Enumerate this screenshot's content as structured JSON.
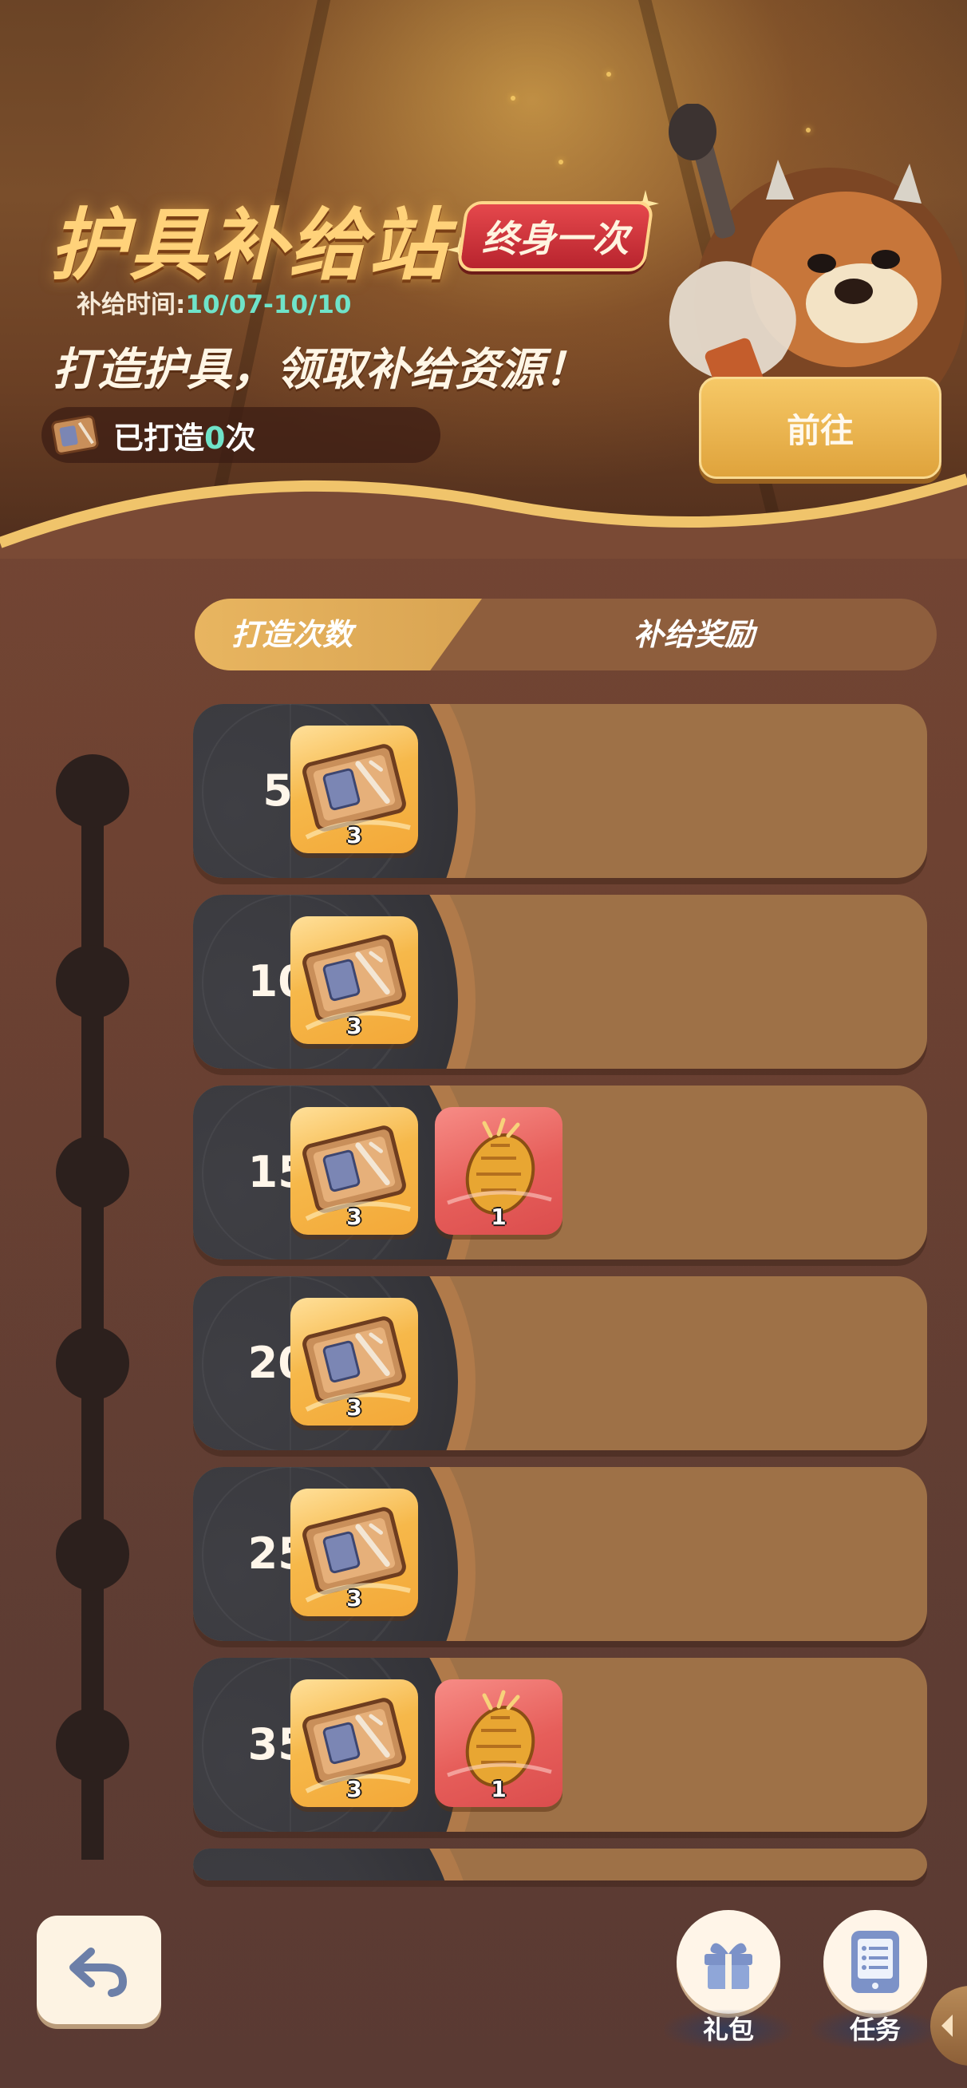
{
  "banner": {
    "title": "护具补给站",
    "badge": "终身一次",
    "supply_time_label": "补给时间:",
    "supply_time_value": "10/07-10/10",
    "subtitle": "打造护具，领取补给资源！",
    "forged_prefix": "已打造",
    "forged_count": "0",
    "forged_suffix": "次",
    "go_button": "前往"
  },
  "table_header": {
    "count_label": "打造次数",
    "reward_label": "补给奖励"
  },
  "tiers": [
    {
      "count": "50",
      "rewards": [
        {
          "icon": "armor-blueprint-icon",
          "qty": "3",
          "color": "gold"
        }
      ]
    },
    {
      "count": "100",
      "rewards": [
        {
          "icon": "armor-blueprint-icon",
          "qty": "3",
          "color": "gold"
        }
      ]
    },
    {
      "count": "150",
      "rewards": [
        {
          "icon": "armor-blueprint-icon",
          "qty": "3",
          "color": "gold"
        },
        {
          "icon": "golden-pinecone-icon",
          "qty": "1",
          "color": "red"
        }
      ]
    },
    {
      "count": "200",
      "rewards": [
        {
          "icon": "armor-blueprint-icon",
          "qty": "3",
          "color": "gold"
        }
      ]
    },
    {
      "count": "250",
      "rewards": [
        {
          "icon": "armor-blueprint-icon",
          "qty": "3",
          "color": "gold"
        }
      ]
    },
    {
      "count": "350",
      "rewards": [
        {
          "icon": "armor-blueprint-icon",
          "qty": "3",
          "color": "gold"
        },
        {
          "icon": "golden-pinecone-icon",
          "qty": "1",
          "color": "red"
        }
      ]
    }
  ],
  "bottom": {
    "gift_label": "礼包",
    "task_label": "任务"
  },
  "colors": {
    "accent_gold": "#e8b560",
    "count_highlight": "#6fe3c9",
    "badge_red": "#d8343a"
  }
}
